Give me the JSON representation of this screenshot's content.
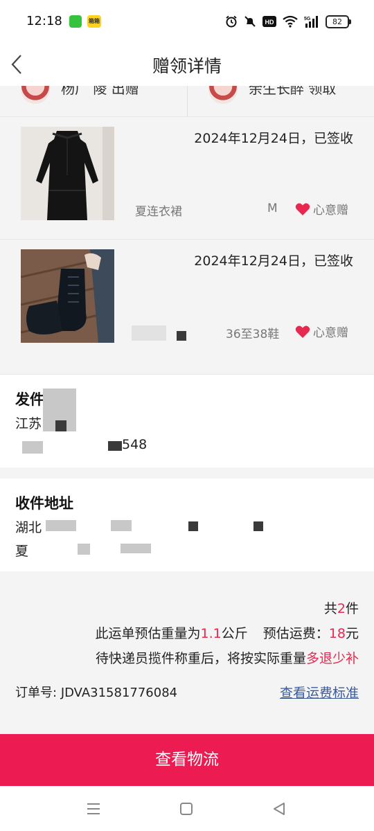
{
  "status_bar": {
    "time": "12:18",
    "app_badge_2": "箱箱",
    "battery": "82"
  },
  "header": {
    "title": "赠领详情"
  },
  "users": {
    "giver_text": "杨广 陵 出赠",
    "receiver_text": "余生长醉 领取"
  },
  "items": [
    {
      "date_status": "2024年12月24日，已签收",
      "name": "夏连衣裙",
      "size": "M",
      "tag": "心意赠"
    },
    {
      "date_status": "2024年12月24日，已签收",
      "name": "",
      "size": "36至38鞋",
      "tag": "心意赠"
    }
  ],
  "sender_address": {
    "title": "发件地址",
    "line1": "江苏",
    "line2": "548"
  },
  "receiver_address": {
    "title": "收件地址",
    "line1": "湖北",
    "line2": "夏"
  },
  "summary": {
    "count_prefix": "共",
    "count": "2",
    "count_suffix": "件",
    "weight_prefix": "此运单预估重量为",
    "weight": "1.1",
    "weight_unit": "公斤",
    "fee_label": "预估运费：",
    "fee": "18",
    "fee_unit": "元",
    "note_prefix": "待快递员揽件称重后，将按实际重量",
    "note_highlight": "多退少补",
    "order_label": "订单号:",
    "order_number": "JDVA31581776084",
    "fee_standard_link": "查看运费标准"
  },
  "cta": {
    "label": "查看物流"
  },
  "colors": {
    "accent": "#ec1b52",
    "highlight_text": "#e8284f",
    "link": "#3a5a9a"
  }
}
